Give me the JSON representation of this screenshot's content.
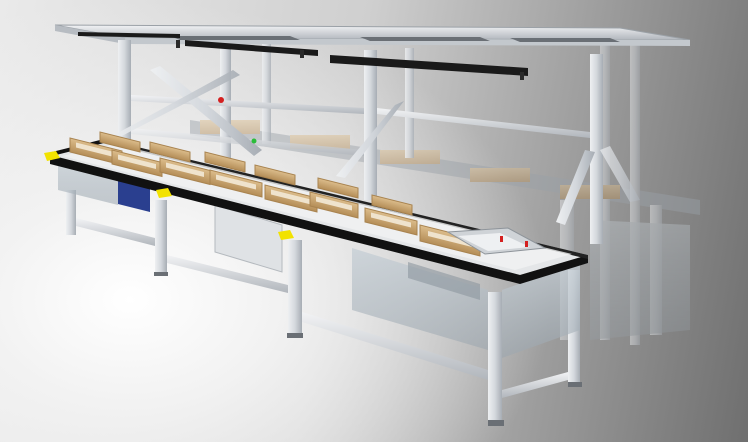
{
  "scene": {
    "subject": "aluminium-profile-assembly-workbench-with-conveyor",
    "colors": {
      "background_light": "#f4f4f4",
      "background_dark": "#6e6e6e",
      "aluminium": "#d7dbe0",
      "aluminium_shadow": "#a9afb6",
      "belt": "#111111",
      "carton": "#c9a574",
      "carton_dark": "#a8834f",
      "marker_yellow": "#f2e200",
      "glass": "#b9c4cc",
      "lamp": "#1a1a1a",
      "blue_bin": "#2a3f8f",
      "indicator_red": "#d42020",
      "indicator_green": "#2bbd3a"
    }
  }
}
